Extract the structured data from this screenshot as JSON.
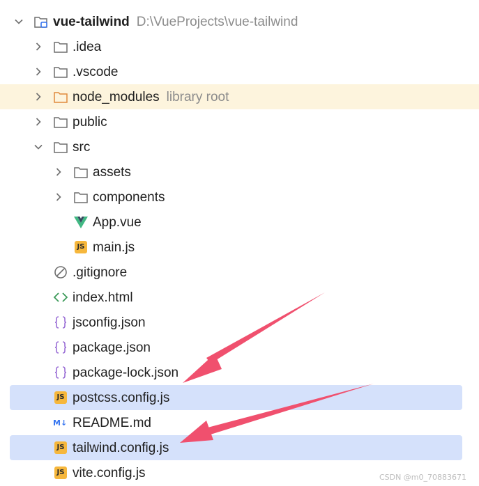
{
  "tree": {
    "root": {
      "name": "vue-tailwind",
      "path": "D:\\VueProjects\\vue-tailwind"
    },
    "idea": {
      "name": ".idea"
    },
    "vscode": {
      "name": ".vscode"
    },
    "node_modules": {
      "name": "node_modules",
      "tag": "library root"
    },
    "public": {
      "name": "public"
    },
    "src": {
      "name": "src"
    },
    "assets": {
      "name": "assets"
    },
    "components": {
      "name": "components"
    },
    "app_vue": {
      "name": "App.vue"
    },
    "main_js": {
      "name": "main.js"
    },
    "gitignore": {
      "name": ".gitignore"
    },
    "index_html": {
      "name": "index.html"
    },
    "jsconfig": {
      "name": "jsconfig.json"
    },
    "package_json": {
      "name": "package.json"
    },
    "package_lock": {
      "name": "package-lock.json"
    },
    "postcss": {
      "name": "postcss.config.js"
    },
    "readme": {
      "name": "README.md"
    },
    "tailwind": {
      "name": "tailwind.config.js"
    },
    "vite": {
      "name": "vite.config.js"
    }
  },
  "badges": {
    "js": "JS"
  },
  "watermark": "CSDN @m0_70883671",
  "colors": {
    "selection": "#d5e1fb",
    "library_root_bg": "#fdf4dd",
    "arrow": "#f0506e",
    "js_badge": "#f6b73c",
    "vue_green": "#41b883",
    "vue_dark": "#35495e"
  },
  "icons": {
    "expanded": "chevron-down-icon",
    "collapsed": "chevron-right-icon",
    "folder": "folder-icon",
    "project": "project-folder-icon",
    "vue": "vue-file-icon",
    "js": "js-file-icon",
    "ignore": "ignore-file-icon",
    "html": "html-file-icon",
    "json": "json-file-icon",
    "markdown": "markdown-file-icon"
  }
}
